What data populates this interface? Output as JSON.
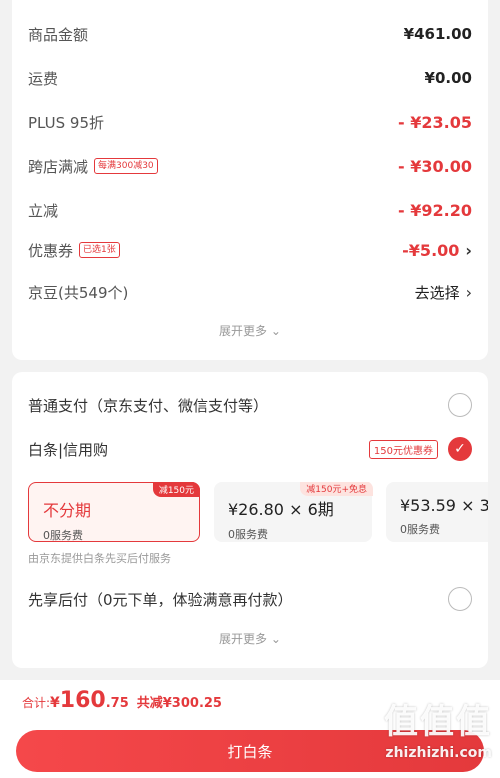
{
  "summary": {
    "rows": [
      {
        "label": "商品金额",
        "value": "¥461.00",
        "tag": ""
      },
      {
        "label": "运费",
        "value": "¥0.00",
        "tag": ""
      },
      {
        "label": "PLUS 95折",
        "value": "- ¥23.05",
        "tag": ""
      },
      {
        "label": "跨店满减",
        "value": "- ¥30.00",
        "tag": "每满300减30"
      },
      {
        "label": "立减",
        "value": "- ¥92.20",
        "tag": ""
      },
      {
        "label": "优惠券",
        "value": "-¥5.00",
        "tag": "已选1张"
      },
      {
        "label": "京豆(共549个)",
        "value": "去选择",
        "tag": ""
      }
    ],
    "more": "展开更多"
  },
  "payment": {
    "general_label": "普通支付（京东支付、微信支付等）",
    "baitiao_label": "白条|信用购",
    "baitiao_coupon": "150元优惠券",
    "plans": [
      {
        "main": "不分期",
        "sub": "0服务费",
        "badge": "减150元"
      },
      {
        "main": "¥26.80 × 6期",
        "sub": "0服务费",
        "badge": "减150元+免息"
      },
      {
        "main": "¥53.59 × 3",
        "sub": "0服务费",
        "badge": ""
      }
    ],
    "provider": "由京东提供白条先买后付服务",
    "later_label": "先享后付（0元下单，体验满意再付款）",
    "more": "展开更多"
  },
  "footer": {
    "total_label": "合计:",
    "total_yen": "¥",
    "total_int": "160",
    "total_dec": ".75",
    "discount": "共减¥300.25",
    "button": "打白条"
  },
  "watermark": {
    "big": "值值值",
    "small": "zhizhizhi.com"
  }
}
